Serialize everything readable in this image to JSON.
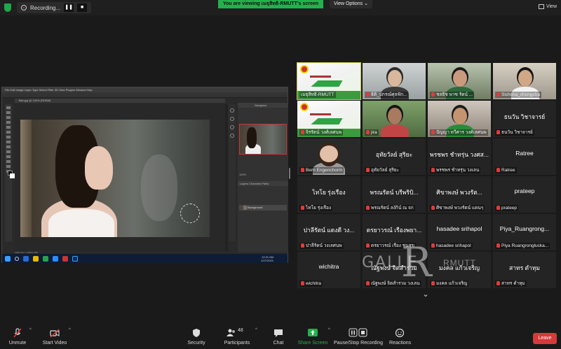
{
  "topbar": {
    "recording_label": "Recording...",
    "pause_icon": "pause-icon",
    "stop_icon": "stop-icon",
    "viewing_banner": "You are viewing เมธุสิทธิ-RMUTT's screen",
    "view_options": "View Options",
    "view_label": "View"
  },
  "colors": {
    "banner_green": "#23b14d",
    "leave_red": "#d63a3a",
    "mute_red": "#e23b3b",
    "active_outline": "#c9c24c",
    "shield_green": "#1ea84a"
  },
  "participants": [
    {
      "label": "เมธุสิทธิ-RMUTT",
      "type": "slide",
      "muted": false,
      "active": true
    },
    {
      "label": "ธิติ_ปกรณ์ศุลฟัก...",
      "type": "cam",
      "muted": true
    },
    {
      "label": "ชลธิช พาซ รัตน์ ...",
      "type": "cam",
      "muted": true
    },
    {
      "label": "Sichcha_chongcha",
      "type": "cam",
      "muted": true
    },
    {
      "label": "จิรรัตน์ วงศ์เลศนพ",
      "type": "slide",
      "muted": true
    },
    {
      "label": "jira",
      "type": "cam",
      "muted": true
    },
    {
      "label": "ปัญญา ทวีศาร วงศ์เลศนพ",
      "type": "cam",
      "muted": true
    },
    {
      "big": "ธนวัน วิชาจารย์",
      "label": "ธนวัน วิชาจารย์",
      "type": "name",
      "muted": true
    },
    {
      "label": "Bern Engenchorm",
      "type": "cam",
      "muted": true
    },
    {
      "big": "อุทัยวัลย์ สุริยะ",
      "label": "อุทัยวัลย์ สุริยะ",
      "type": "name",
      "muted": true
    },
    {
      "big": "พรชพร ชำทรุ่น วงศส...",
      "label": "พรชพร ชำทรุ่น วงเลน",
      "type": "name",
      "muted": true
    },
    {
      "big": "Ratree",
      "label": "Ratree",
      "type": "name",
      "muted": true
    },
    {
      "big": "ไทโย รุ่งเรือง",
      "label": "ไทโย รุ่งเรือง",
      "type": "name",
      "muted": true
    },
    {
      "big": "พรณรัตน์ บรีพริบิ...",
      "label": "พรณรัตน์ ลงักิน์ ณ จก",
      "type": "name",
      "muted": true
    },
    {
      "big": "ศิขาพงษ์ พวงรัต...",
      "label": "ศิขาพงษ์ พวงรัตน์ แดนๆ",
      "type": "name",
      "muted": true
    },
    {
      "big": "prateep",
      "label": "prateep",
      "type": "name",
      "muted": true
    },
    {
      "big": "ปาลีรัตน์ แดงดี วง...",
      "label": "ปาลีรัตน์ วงเลศนพ",
      "type": "name",
      "muted": true
    },
    {
      "big": "ดรยาวรณ์ เรืองพยา...",
      "label": "ดรยาวรณ์ เรือง ชนสุข",
      "type": "name",
      "muted": true
    },
    {
      "big": "hasadee srihapol",
      "label": "hasadee srihapol",
      "type": "name",
      "muted": true
    },
    {
      "big": "Piya_Ruangrong...",
      "label": "Piya Ruangronglucka...",
      "type": "name",
      "muted": true
    },
    {
      "big": "wichitra",
      "label": "wichitra",
      "type": "name",
      "muted": true
    },
    {
      "big": "ณัฐพงษ์ จิตสำรวม",
      "label": "ณัฐพงษ์ จิตสำรวม วงเลน",
      "type": "name",
      "muted": true
    },
    {
      "big": "มงคล แก้วเจริญ",
      "label": "มงคล แก้วเจริญ",
      "type": "name",
      "muted": true
    },
    {
      "big": "สาทร ตำหุม",
      "label": "สาทร ตำหุม",
      "type": "name",
      "muted": true
    }
  ],
  "watermark": {
    "gal": "GALLE",
    "r": "R",
    "sub": "RMUTT"
  },
  "photoshop": {
    "tab_label": "Bkk.jpg @ 100% (RGB/8)",
    "panel_title": "Navigator",
    "zoom": "100%",
    "layer_name": "Background",
    "layers_tabs": "Layers  Channels  Paths",
    "status": "100%   Doc: 2.36M/2.36M",
    "clock": "10:31 AM",
    "date": "1/27/2021",
    "menu": "File  Edit  Image  Layer  Type  Select  Filter  3D  View  Plugins  Window  Help"
  },
  "toolbar": {
    "unmute": "Unmute",
    "start_video": "Start Video",
    "security": "Security",
    "participants": "Participants",
    "participants_count": "48",
    "chat": "Chat",
    "share_screen": "Share Screen",
    "record": "Pause/Stop Recording",
    "reactions": "Reactions",
    "leave": "Leave"
  }
}
